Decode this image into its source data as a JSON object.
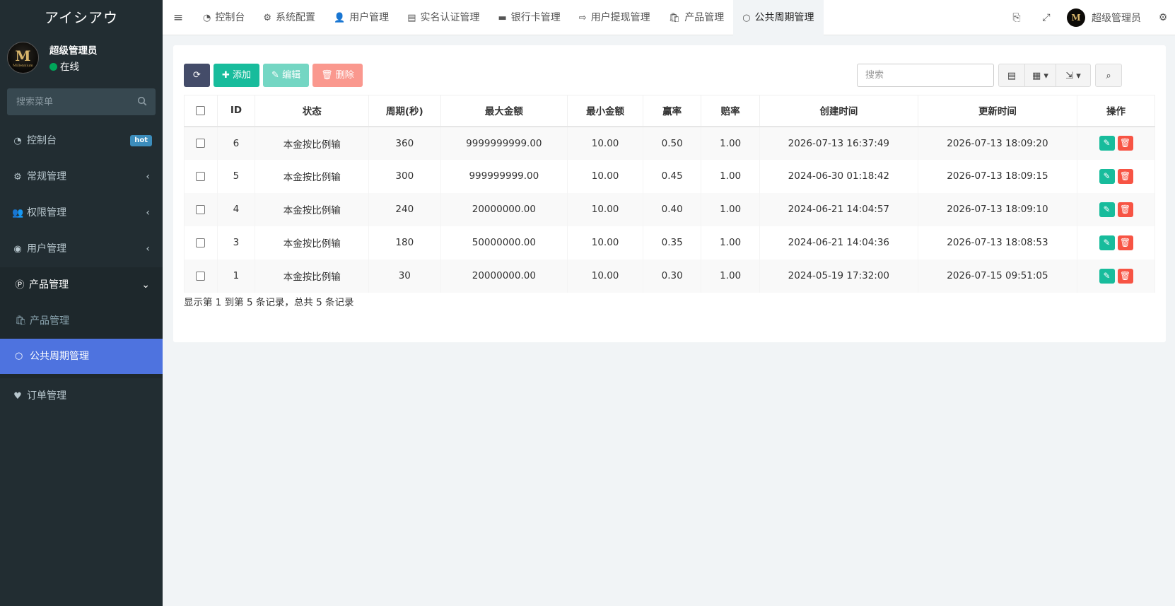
{
  "app": {
    "brand": "アイシアウ",
    "logo_text": "M",
    "logo_sub": "Millennium"
  },
  "user": {
    "name": "超级管理员",
    "status": "在线"
  },
  "sidebar": {
    "search_placeholder": "搜索菜单",
    "items": [
      {
        "label": "控制台",
        "icon": "dashboard-icon",
        "badge": "hot"
      },
      {
        "label": "常规管理",
        "icon": "cogs-icon"
      },
      {
        "label": "权限管理",
        "icon": "group-icon"
      },
      {
        "label": "用户管理",
        "icon": "user-circle-icon"
      },
      {
        "label": "产品管理",
        "icon": "product-icon"
      }
    ],
    "submenu": [
      {
        "label": "产品管理",
        "icon": "shopping-bag-icon"
      },
      {
        "label": "公共周期管理",
        "icon": "circle-icon"
      }
    ],
    "after": {
      "label": "订单管理",
      "icon": "heartbeat-icon"
    }
  },
  "tabs": [
    {
      "label": "控制台",
      "icon": "dashboard-icon"
    },
    {
      "label": "系统配置",
      "icon": "cog-icon"
    },
    {
      "label": "用户管理",
      "icon": "user-icon"
    },
    {
      "label": "实名认证管理",
      "icon": "id-card-icon"
    },
    {
      "label": "银行卡管理",
      "icon": "credit-card-icon"
    },
    {
      "label": "用户提现管理",
      "icon": "sign-out-icon"
    },
    {
      "label": "产品管理",
      "icon": "shopping-bag-icon"
    },
    {
      "label": "公共周期管理",
      "icon": "circle-icon",
      "active": true
    }
  ],
  "navbar": {
    "user_name": "超级管理员"
  },
  "toolbar": {
    "add_label": "添加",
    "edit_label": "编辑",
    "delete_label": "删除",
    "search_placeholder": "搜索"
  },
  "table": {
    "headers": [
      "ID",
      "状态",
      "周期(秒)",
      "最大金额",
      "最小金额",
      "赢率",
      "赔率",
      "创建时间",
      "更新时间",
      "操作"
    ],
    "rows": [
      {
        "id": "6",
        "status": "本金按比例输",
        "period": "360",
        "max": "9999999999.00",
        "min": "10.00",
        "win": "0.50",
        "odds": "1.00",
        "created": "2026-07-13 16:37:49",
        "updated": "2026-07-13 18:09:20"
      },
      {
        "id": "5",
        "status": "本金按比例输",
        "period": "300",
        "max": "999999999.00",
        "min": "10.00",
        "win": "0.45",
        "odds": "1.00",
        "created": "2024-06-30 01:18:42",
        "updated": "2026-07-13 18:09:15"
      },
      {
        "id": "4",
        "status": "本金按比例输",
        "period": "240",
        "max": "20000000.00",
        "min": "10.00",
        "win": "0.40",
        "odds": "1.00",
        "created": "2024-06-21 14:04:57",
        "updated": "2026-07-13 18:09:10"
      },
      {
        "id": "3",
        "status": "本金按比例输",
        "period": "180",
        "max": "50000000.00",
        "min": "10.00",
        "win": "0.35",
        "odds": "1.00",
        "created": "2024-06-21 14:04:36",
        "updated": "2026-07-13 18:08:53"
      },
      {
        "id": "1",
        "status": "本金按比例输",
        "period": "30",
        "max": "20000000.00",
        "min": "10.00",
        "win": "0.30",
        "odds": "1.00",
        "created": "2024-05-19 17:32:00",
        "updated": "2026-07-15 09:51:05"
      }
    ],
    "pager_info": "显示第 1 到第 5 条记录，总共 5 条记录"
  },
  "colors": {
    "sidebar_bg": "#222d32",
    "active_item": "#4e73df",
    "success": "#18bc9c",
    "danger": "#f75444",
    "refresh": "#444c69"
  }
}
